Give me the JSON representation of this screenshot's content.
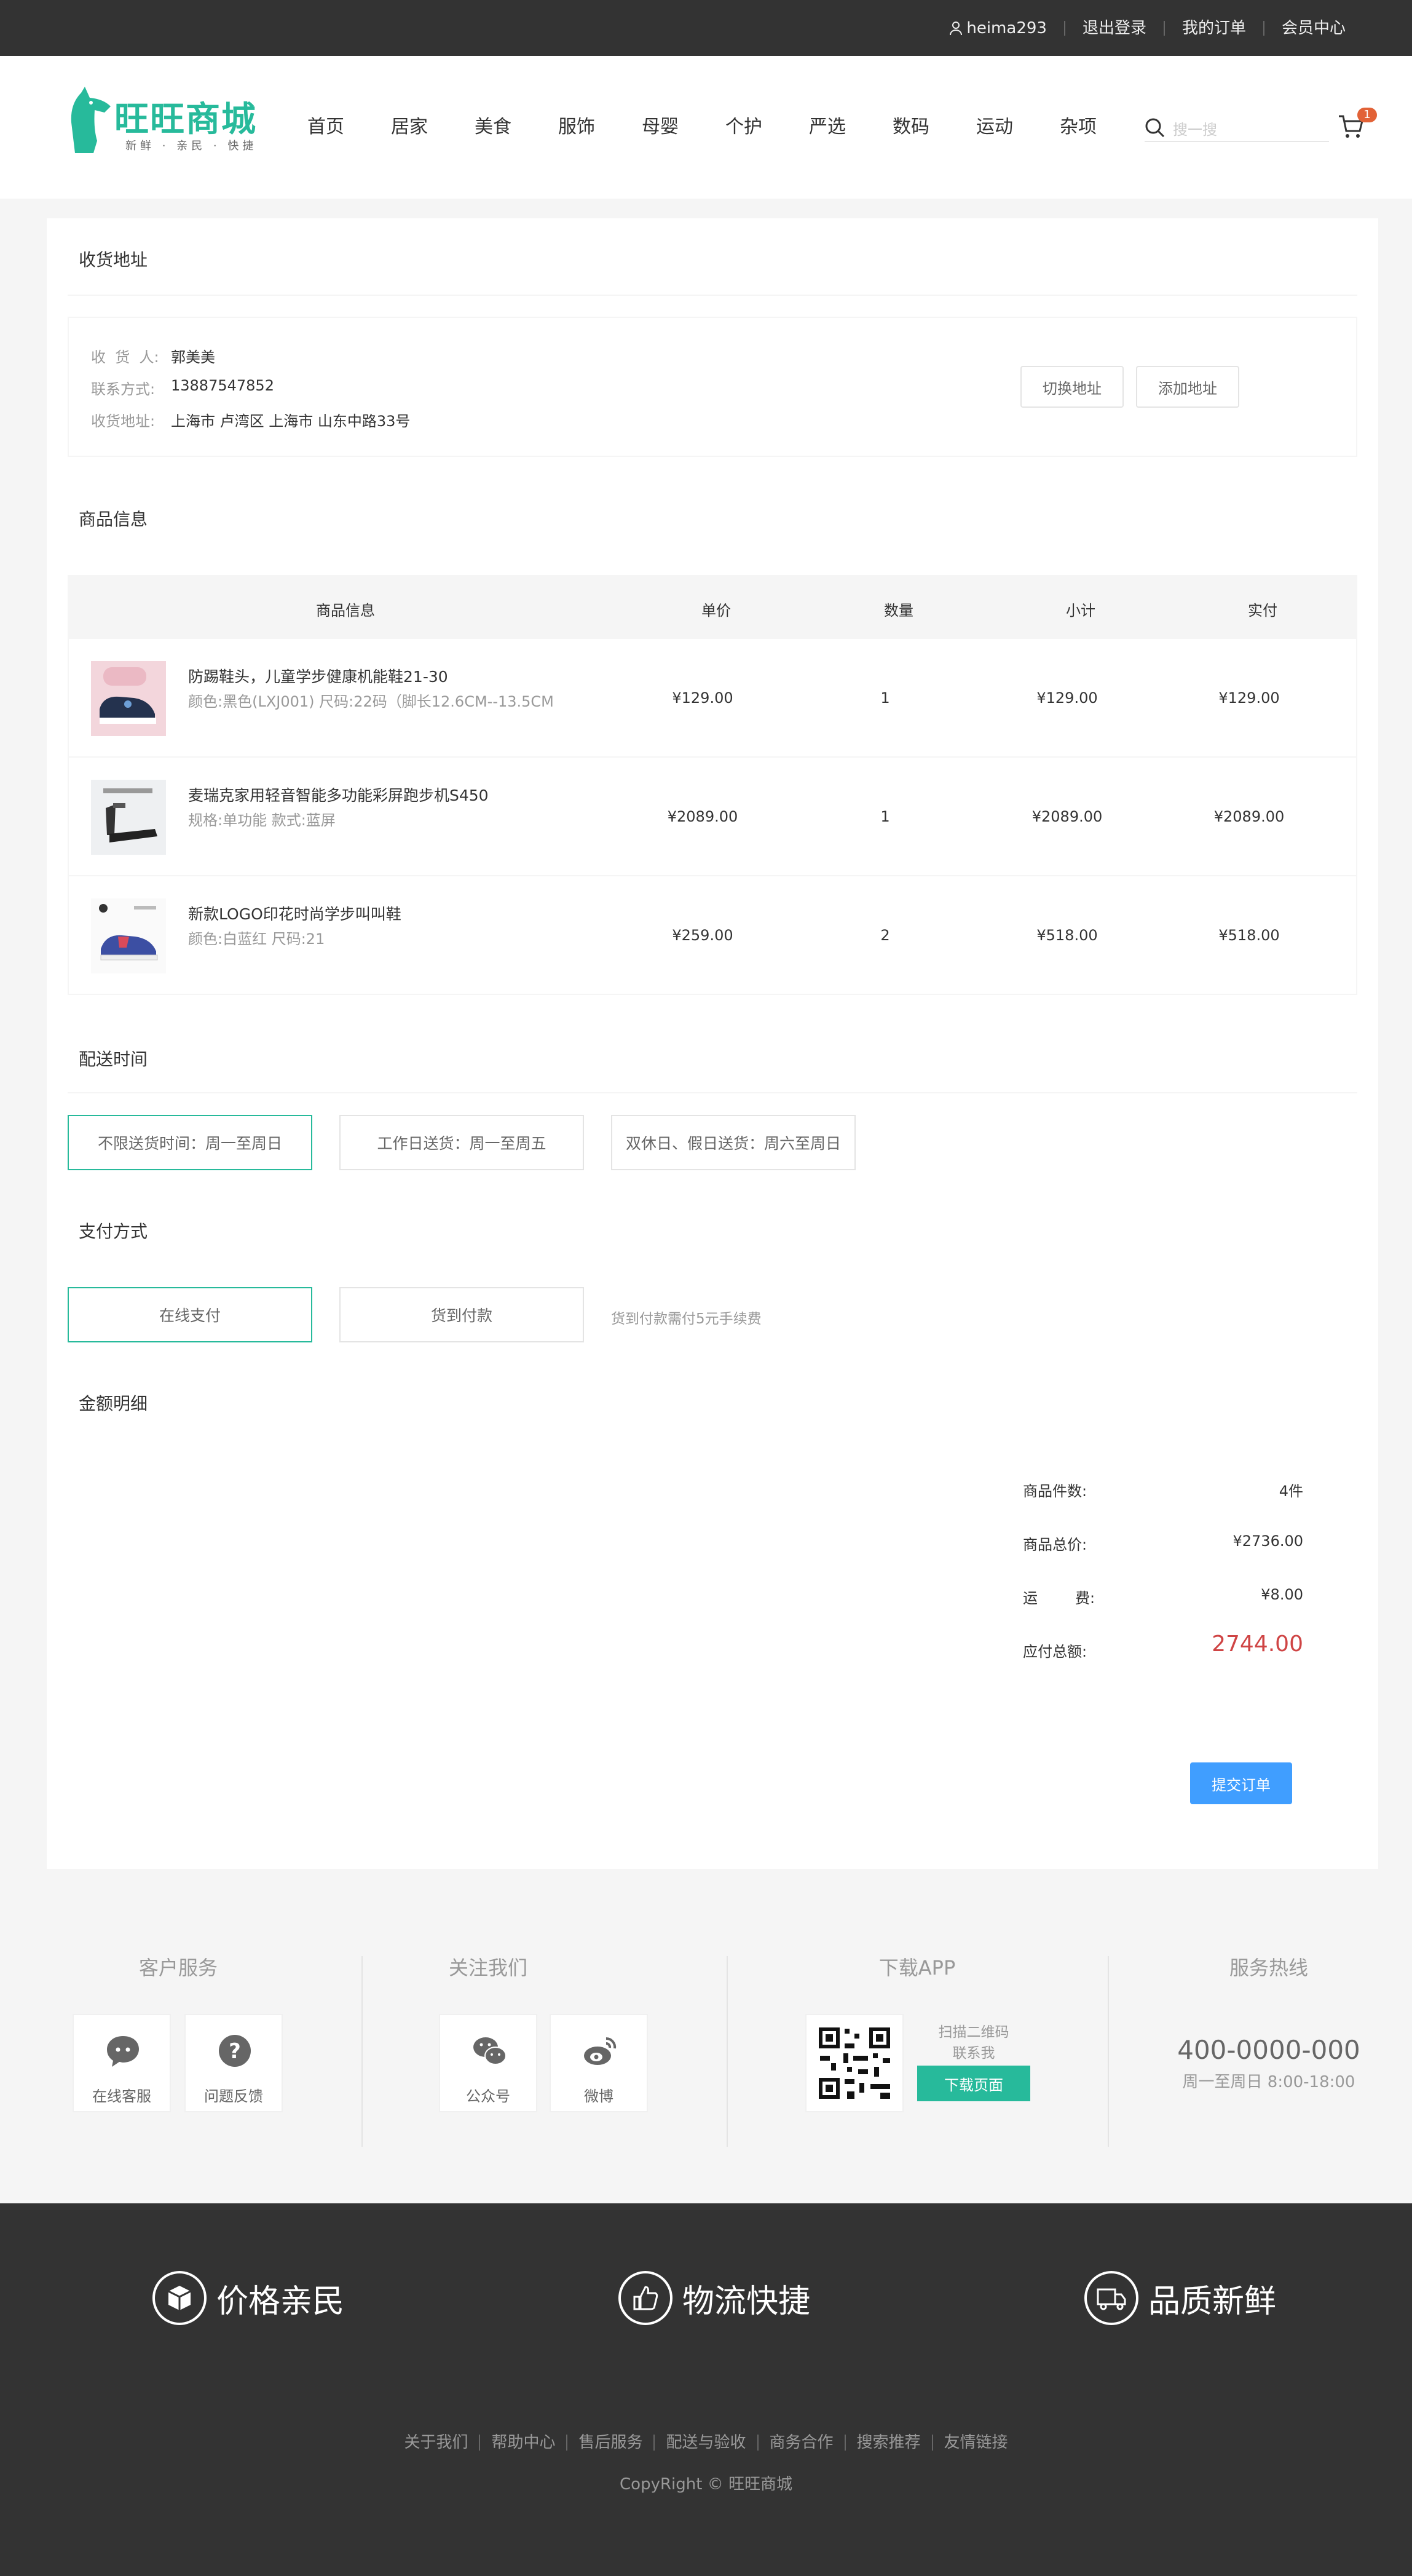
{
  "topbar": {
    "username": "heima293",
    "logout": "退出登录",
    "orders": "我的订单",
    "member": "会员中心"
  },
  "header": {
    "brand": "旺旺商城",
    "slogan": "新鲜 · 亲民 · 快捷",
    "nav": [
      "首页",
      "居家",
      "美食",
      "服饰",
      "母婴",
      "个护",
      "严选",
      "数码",
      "运动",
      "杂项"
    ],
    "search_placeholder": "搜一搜",
    "cart_count": "1"
  },
  "address": {
    "title": "收货地址",
    "receiver_label": "收  货  人:",
    "receiver": "郭美美",
    "phone_label": "联系方式:",
    "phone": "13887547852",
    "addr_label": "收货地址:",
    "addr": "上海市 卢湾区 上海市 山东中路33号",
    "switch_btn": "切换地址",
    "add_btn": "添加地址"
  },
  "goods": {
    "title": "商品信息",
    "headers": [
      "商品信息",
      "单价",
      "数量",
      "小计",
      "实付"
    ],
    "items": [
      {
        "name": "防踢鞋头，儿童学步健康机能鞋21-30",
        "attr": "颜色:黑色(LXJ001) 尺码:22码（脚长12.6CM--13.5CM",
        "price": "¥129.00",
        "qty": "1",
        "subtotal": "¥129.00",
        "paid": "¥129.00"
      },
      {
        "name": "麦瑞克家用轻音智能多功能彩屏跑步机S450",
        "attr": "规格:单功能 款式:蓝屏",
        "price": "¥2089.00",
        "qty": "1",
        "subtotal": "¥2089.00",
        "paid": "¥2089.00"
      },
      {
        "name": "新款LOGO印花时尚学步叫叫鞋",
        "attr": "颜色:白蓝红 尺码:21",
        "price": "¥259.00",
        "qty": "2",
        "subtotal": "¥518.00",
        "paid": "¥518.00"
      }
    ]
  },
  "delivery": {
    "title": "配送时间",
    "options": [
      "不限送货时间：周一至周日",
      "工作日送货：周一至周五",
      "双休日、假日送货：周六至周日"
    ]
  },
  "payment": {
    "title": "支付方式",
    "online": "在线支付",
    "cod": "货到付款",
    "note": "货到付款需付5元手续费"
  },
  "summary": {
    "title": "金额明细",
    "count_label": "商品件数:",
    "count": "4件",
    "total_label": "商品总价:",
    "total": "¥2736.00",
    "freight_label": "运        费:",
    "freight": "¥8.00",
    "pay_label": "应付总额:",
    "pay": "2744.00",
    "submit": "提交订单"
  },
  "service": {
    "customer_title": "客户服务",
    "online_service": "在线客服",
    "feedback": "问题反馈",
    "follow_title": "关注我们",
    "wechat": "公众号",
    "weibo": "微博",
    "app_title": "下载APP",
    "scan": "扫描二维码",
    "contact": "联系我",
    "download": "下载页面",
    "hotline_title": "服务热线",
    "phone": "400-0000-000",
    "hours": "周一至周日 8:00-18:00"
  },
  "footer": {
    "promises": [
      "价格亲民",
      "物流快捷",
      "品质新鲜"
    ],
    "links": [
      "关于我们",
      "帮助中心",
      "售后服务",
      "配送与验收",
      "商务合作",
      "搜索推荐",
      "友情链接"
    ],
    "copyright": "CopyRight © 旺旺商城"
  },
  "colors": {
    "accent": "#27ba9b",
    "price_red": "#cf4444",
    "submit_blue": "#409eff",
    "badge": "#e26237"
  }
}
